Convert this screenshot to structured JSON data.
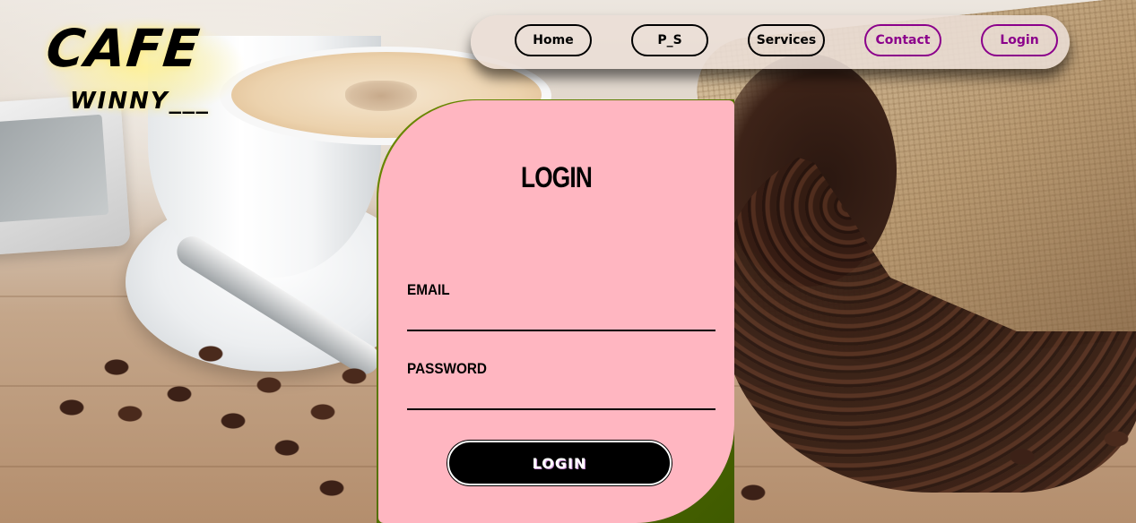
{
  "brand": {
    "title": "CAFE",
    "subtitle": "WINNY___"
  },
  "nav": {
    "items": [
      {
        "label": "Home"
      },
      {
        "label": "P_S"
      },
      {
        "label": "Services"
      },
      {
        "label": "Contact"
      },
      {
        "label": "Login"
      }
    ]
  },
  "login_form": {
    "title": "LOGIN",
    "email_label": "EMAIL",
    "email_value": "",
    "password_label": "PASSWORD",
    "password_value": "",
    "submit_label": "LOGIN"
  },
  "colors": {
    "card_background": "#ffb6c1",
    "card_corner_accent": "#6b8a00",
    "nav_accent": "#8b008b",
    "button_background": "#000000"
  }
}
